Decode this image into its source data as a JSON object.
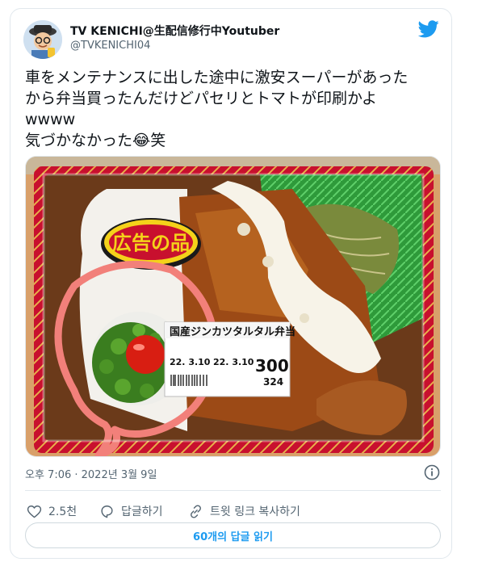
{
  "tweet": {
    "author_name": "TV KENICHI@生配信修行中Youtuber",
    "author_handle": "@TVKENICHI04",
    "text": "車をメンテナンスに出した途中に激安スーパーがあった\nから弁当買ったんだけどパセリとトマトが印刷かよ\nwwww\n気づかなかった😂笑",
    "timestamp": "오후 7:06 · 2022년 3월 9일"
  },
  "photo": {
    "badge_text": "広告の品",
    "label_title": "国産ジンカツタルタル弁当",
    "label_date1": "22. 3.10",
    "label_date2": "22. 3.10",
    "price_main": "300",
    "price_tax": "324"
  },
  "actions": {
    "like_count": "2.5천",
    "reply_label": "답글하기",
    "copy_link_label": "트윗 링크 복사하기"
  },
  "replies_button": "60개의 답글 읽기",
  "colors": {
    "accent": "#1d9bf0",
    "like": "#536471"
  },
  "icons": [
    "twitter-bird-icon",
    "info-icon",
    "heart-icon",
    "reply-icon",
    "link-icon"
  ]
}
